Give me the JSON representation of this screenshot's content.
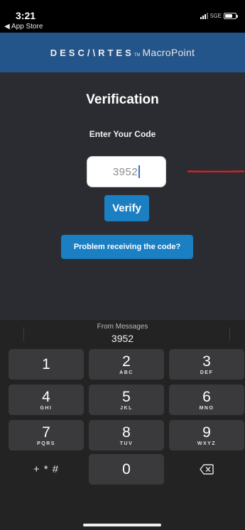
{
  "status_bar": {
    "time": "3:21",
    "back_label": "◀ App Store",
    "network": "5GE"
  },
  "header": {
    "brand_main": "DESC/\\RTES",
    "brand_tm": "TM",
    "brand_sub": "MacroPoint"
  },
  "verification": {
    "title": "Verification",
    "subtitle": "Enter Your Code",
    "code_value": "3952",
    "verify_label": "Verify",
    "problem_label": "Problem receiving the code?"
  },
  "annotation": {
    "color": "#d6202a"
  },
  "keyboard": {
    "suggestion_label": "From Messages",
    "suggestion_code": "3952",
    "keys": [
      {
        "digit": "1",
        "letters": ""
      },
      {
        "digit": "2",
        "letters": "ABC"
      },
      {
        "digit": "3",
        "letters": "DEF"
      },
      {
        "digit": "4",
        "letters": "GHI"
      },
      {
        "digit": "5",
        "letters": "JKL"
      },
      {
        "digit": "6",
        "letters": "MNO"
      },
      {
        "digit": "7",
        "letters": "PQRS"
      },
      {
        "digit": "8",
        "letters": "TUV"
      },
      {
        "digit": "9",
        "letters": "WXYZ"
      },
      {
        "symbols_label": "+ * #"
      },
      {
        "digit": "0"
      },
      {
        "icon": "delete-backspace-icon"
      }
    ]
  },
  "colors": {
    "brand_bar": "#24558a",
    "panel": "#2a2c31",
    "button": "#1b7fc4",
    "keyboard": "#232323"
  }
}
